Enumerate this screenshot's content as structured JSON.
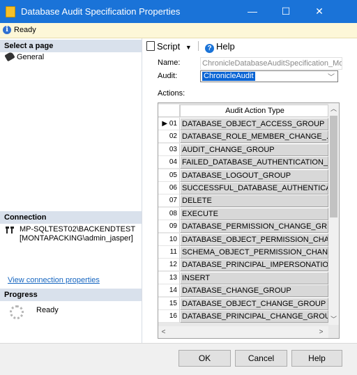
{
  "window": {
    "title": "Database Audit Specification Properties",
    "controls": {
      "minimize": "—",
      "maximize": "☐",
      "close": "✕"
    }
  },
  "status": {
    "text": "Ready",
    "icon": "info-icon"
  },
  "left_panel": {
    "select_page_header": "Select a page",
    "pages": [
      {
        "label": "General",
        "icon": "wrench-icon"
      }
    ],
    "connection_header": "Connection",
    "connection_server": "MP-SQLTEST02\\BACKENDTEST",
    "connection_user": "[MONTAPACKING\\admin_jasper]",
    "view_connection_link": "View connection properties",
    "progress_header": "Progress",
    "progress_status": "Ready"
  },
  "toolbar": {
    "script_label": "Script",
    "help_label": "Help"
  },
  "form": {
    "name_label": "Name:",
    "name_value": "ChronicleDatabaseAuditSpecification_Mo",
    "audit_label": "Audit:",
    "audit_value": "ChronicleAudit",
    "actions_label": "Actions:"
  },
  "grid": {
    "column_header": "Audit Action Type",
    "rows": [
      {
        "num": "▶ 01",
        "value": "DATABASE_OBJECT_ACCESS_GROUP"
      },
      {
        "num": "02",
        "value": "DATABASE_ROLE_MEMBER_CHANGE_..."
      },
      {
        "num": "03",
        "value": "AUDIT_CHANGE_GROUP"
      },
      {
        "num": "04",
        "value": "FAILED_DATABASE_AUTHENTICATION_..."
      },
      {
        "num": "05",
        "value": "DATABASE_LOGOUT_GROUP"
      },
      {
        "num": "06",
        "value": "SUCCESSFUL_DATABASE_AUTHENTICA..."
      },
      {
        "num": "07",
        "value": "DELETE"
      },
      {
        "num": "08",
        "value": "EXECUTE"
      },
      {
        "num": "09",
        "value": "DATABASE_PERMISSION_CHANGE_GR..."
      },
      {
        "num": "10",
        "value": "DATABASE_OBJECT_PERMISSION_CHA..."
      },
      {
        "num": "11",
        "value": "SCHEMA_OBJECT_PERMISSION_CHAN..."
      },
      {
        "num": "12",
        "value": "DATABASE_PRINCIPAL_IMPERSONATIO..."
      },
      {
        "num": "13",
        "value": "INSERT"
      },
      {
        "num": "14",
        "value": "DATABASE_CHANGE_GROUP"
      },
      {
        "num": "15",
        "value": "DATABASE_OBJECT_CHANGE_GROUP"
      },
      {
        "num": "16",
        "value": "DATABASE_PRINCIPAL_CHANGE_GROUP"
      }
    ]
  },
  "buttons": {
    "ok": "OK",
    "cancel": "Cancel",
    "help": "Help"
  },
  "colors": {
    "titlebar": "#1a73d8",
    "status_bg": "#fdf7d8",
    "section_header": "#d9e1ec",
    "selection": "#0a64d4"
  }
}
